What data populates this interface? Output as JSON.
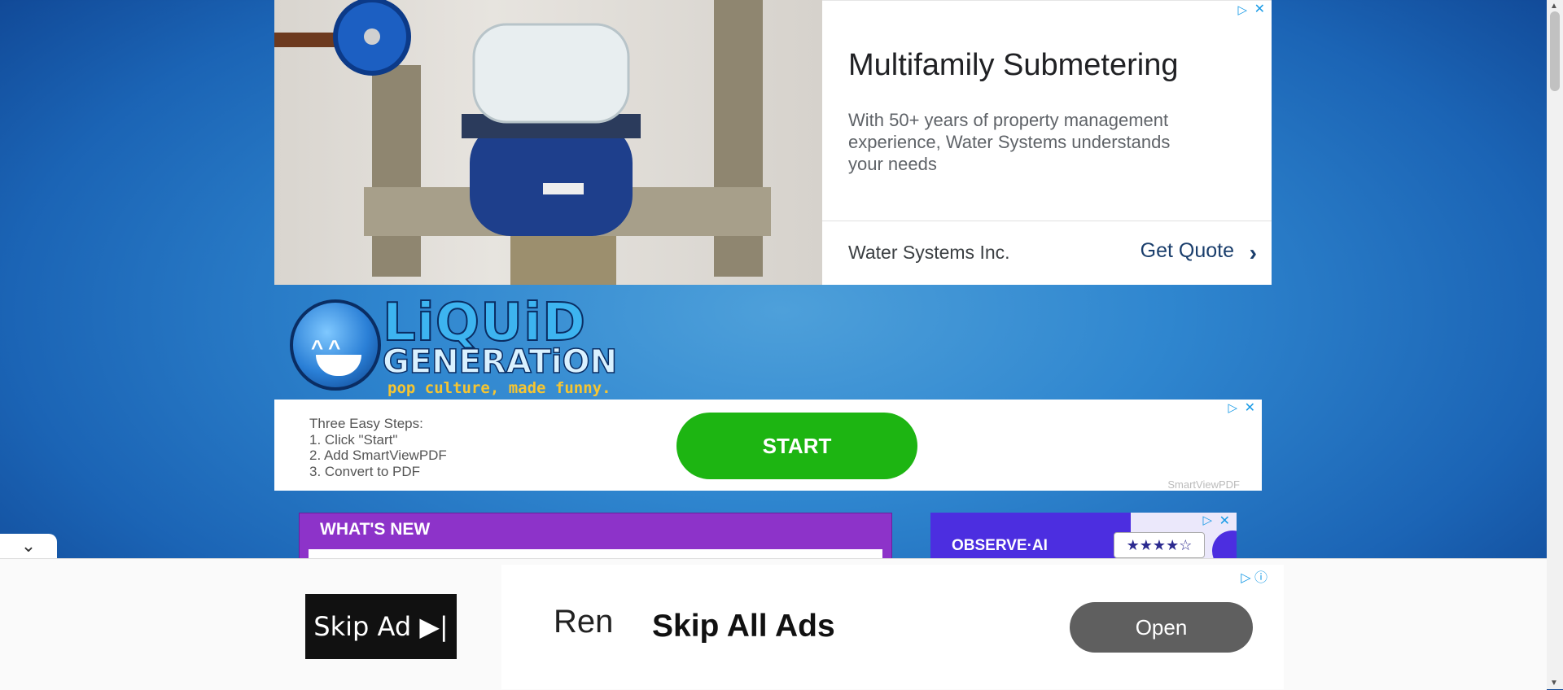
{
  "top_ad": {
    "title": "Multifamily Submetering",
    "description": "With 50+ years of property management experience, Water Systems understands your needs",
    "advertiser": "Water Systems Inc.",
    "cta": "Get Quote",
    "cta_chevron": "›",
    "adchoices_glyph": "▷",
    "close_glyph": "✕"
  },
  "logo": {
    "word1": "LiQUiD",
    "word2": "GENERATiON",
    "tagline": "pop culture, made funny."
  },
  "start_ad": {
    "steps": [
      "Three Easy Steps:",
      "1. Click \"Start\"",
      "2. Add SmartViewPDF",
      "3. Convert to PDF"
    ],
    "button": "START",
    "brand": "SmartViewPDF",
    "adchoices_glyph": "▷",
    "close_glyph": "✕"
  },
  "whats_new": {
    "header": "WHAT'S NEW"
  },
  "observe_ad": {
    "brand": "OBSERVE·AI",
    "rating": "★★★★☆",
    "adchoices_glyph": "▷",
    "close_glyph": "✕"
  },
  "collapse": {
    "glyph": "⌄"
  },
  "bottom_ad": {
    "skip_ad": "Skip Ad ▶|",
    "partial_text": "Ren",
    "headline": "Skip All Ads",
    "open": "Open",
    "adchoices_glyph": "▷ ⓘ"
  },
  "scrollbar": {
    "up": "▲",
    "down": "▼"
  },
  "colors": {
    "background": "#2f86cf",
    "start_green": "#1db512",
    "whats_new_purple": "#8d33c9",
    "observe_purple": "#4c2ee0"
  }
}
